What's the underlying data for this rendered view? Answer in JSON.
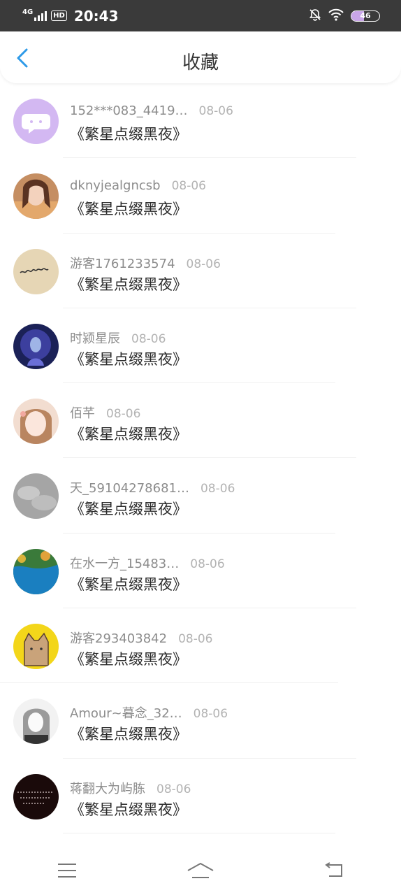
{
  "status_bar": {
    "network": "4G",
    "hd": "HD",
    "time": "20:43",
    "battery": "46",
    "battery_level": 0.46,
    "icons": [
      "signal-bars-icon",
      "bell-off-icon",
      "wifi-icon",
      "battery-icon"
    ]
  },
  "header": {
    "title": "收藏",
    "back_icon": "chevron-left-icon",
    "accent_color": "#2d9ae8"
  },
  "items": [
    {
      "user": "152***083_4419…",
      "date": "08-06",
      "book": "《繁星点缀黑夜》",
      "avatar": "chat-bubble-avatar"
    },
    {
      "user": "dknyjealgncsb",
      "date": "08-06",
      "book": "《繁星点缀黑夜》",
      "avatar": "girl-photo-avatar"
    },
    {
      "user": "游客1761233574",
      "date": "08-06",
      "book": "《繁星点缀黑夜》",
      "avatar": "handwriting-avatar"
    },
    {
      "user": "时颍星辰",
      "date": "08-06",
      "book": "《繁星点缀黑夜》",
      "avatar": "fantasy-art-avatar"
    },
    {
      "user": "佰芊",
      "date": "08-06",
      "book": "《繁星点缀黑夜》",
      "avatar": "anime-girl-avatar"
    },
    {
      "user": "天_59104278681…",
      "date": "08-06",
      "book": "《繁星点缀黑夜》",
      "avatar": "grey-clouds-avatar"
    },
    {
      "user": "在水一方_15483…",
      "date": "08-06",
      "book": "《繁星点缀黑夜》",
      "avatar": "lake-landscape-avatar"
    },
    {
      "user": "游客293403842",
      "date": "08-06",
      "book": "《繁星点缀黑夜》",
      "avatar": "cat-drawing-avatar"
    },
    {
      "user": "Amour~暮念_32…",
      "date": "08-06",
      "book": "《繁星点缀黑夜》",
      "avatar": "sketch-girl-avatar"
    },
    {
      "user": "蒋翻大为屿胨",
      "date": "08-06",
      "book": "《繁星点缀黑夜》",
      "avatar": "dark-text-avatar"
    }
  ],
  "nav_bar": {
    "icons": [
      "menu-icon",
      "home-icon",
      "back-icon"
    ]
  }
}
